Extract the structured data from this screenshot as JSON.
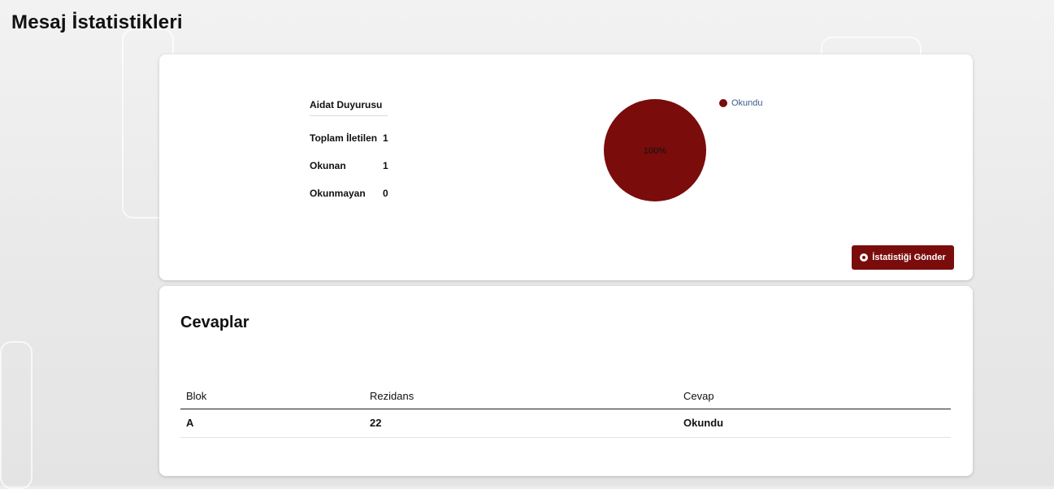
{
  "page": {
    "title": "Mesaj İstatistikleri"
  },
  "stats": {
    "message_title": "Aidat Duyurusu",
    "rows": [
      {
        "label": "Toplam İletilen",
        "value": "1"
      },
      {
        "label": "Okunan",
        "value": "1"
      },
      {
        "label": "Okunmayan",
        "value": "0"
      }
    ]
  },
  "chart_data": {
    "type": "pie",
    "slices": [
      {
        "label": "Okundu",
        "value": 100,
        "color": "#7a0c0c"
      }
    ],
    "data_labels": [
      "100%"
    ],
    "legend": {
      "placement": "top-right",
      "entries": [
        "Okundu"
      ]
    }
  },
  "actions": {
    "send_stats_label": "İstatistiği Gönder",
    "send_icon": "send-icon"
  },
  "answers": {
    "title": "Cevaplar",
    "columns": [
      "Blok",
      "Rezidans",
      "Cevap"
    ],
    "rows": [
      [
        "A",
        "22",
        "Okundu"
      ]
    ]
  },
  "colors": {
    "accent": "#7a0c0c",
    "legend_text": "#3b5b8a"
  }
}
